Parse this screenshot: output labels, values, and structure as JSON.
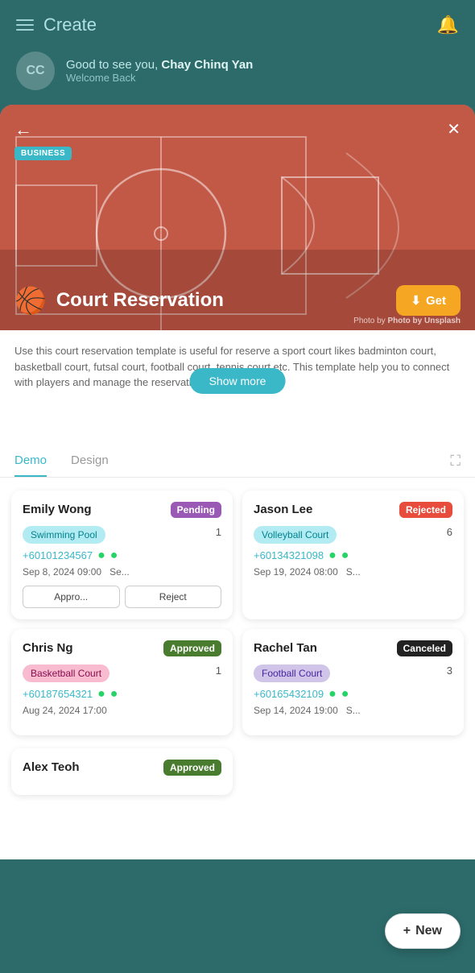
{
  "header": {
    "title": "Create",
    "bell_label": "🔔"
  },
  "greeting": {
    "avatar_initials": "CC",
    "good_to_see": "Good to see you,",
    "user_name": "Chay Chinq Yan",
    "welcome": "Welcome Back"
  },
  "modal": {
    "business_badge": "BUSINESS",
    "title": "Court Reservation",
    "get_label": "Get",
    "photo_credit": "Photo by Unsplash",
    "description": "Use this court reservation template is useful for reserve a sport court likes badminton court, basketball court, futsal court, football court, tennis court etc. This template help you to connect with players and manage the reservation.",
    "show_more": "Show more",
    "back_arrow": "←",
    "close_x": "✕",
    "download_icon": "⬇"
  },
  "tabs": {
    "demo_label": "Demo",
    "design_label": "Design",
    "expand_label": "⛶"
  },
  "cards": [
    {
      "name": "Emily Wong",
      "status": "Pending",
      "status_type": "pending",
      "court": "Swimming Pool",
      "court_type": "cyan",
      "count": "1",
      "phone": "+60101234567",
      "datetime": "Sep 8, 2024 09:00",
      "extra": "Se...",
      "has_actions": true,
      "action1": "Appro...",
      "action2": "Reject"
    },
    {
      "name": "Jason Lee",
      "status": "Rejected",
      "status_type": "rejected",
      "court": "Volleyball Court",
      "court_type": "volleyball",
      "count": "6",
      "phone": "+60134321098",
      "datetime": "Sep 19, 2024 08:00",
      "extra": "S...",
      "has_actions": false
    },
    {
      "name": "Chris Ng",
      "status": "Approved",
      "status_type": "approved",
      "court": "Basketball Court",
      "court_type": "basketball",
      "count": "1",
      "phone": "+60187654321",
      "datetime": "Aug 24, 2024 17:00",
      "extra": "",
      "has_actions": false
    },
    {
      "name": "Rachel Tan",
      "status": "Canceled",
      "status_type": "canceled",
      "court": "Football Court",
      "court_type": "football",
      "count": "3",
      "phone": "+60165432109",
      "datetime": "Sep 14, 2024 19:00",
      "extra": "S...",
      "has_actions": false
    }
  ],
  "bottom_cards": [
    {
      "name": "Alex Teoh",
      "status": "Approved",
      "status_type": "approved"
    }
  ],
  "fab": {
    "label": "New",
    "plus": "+"
  }
}
